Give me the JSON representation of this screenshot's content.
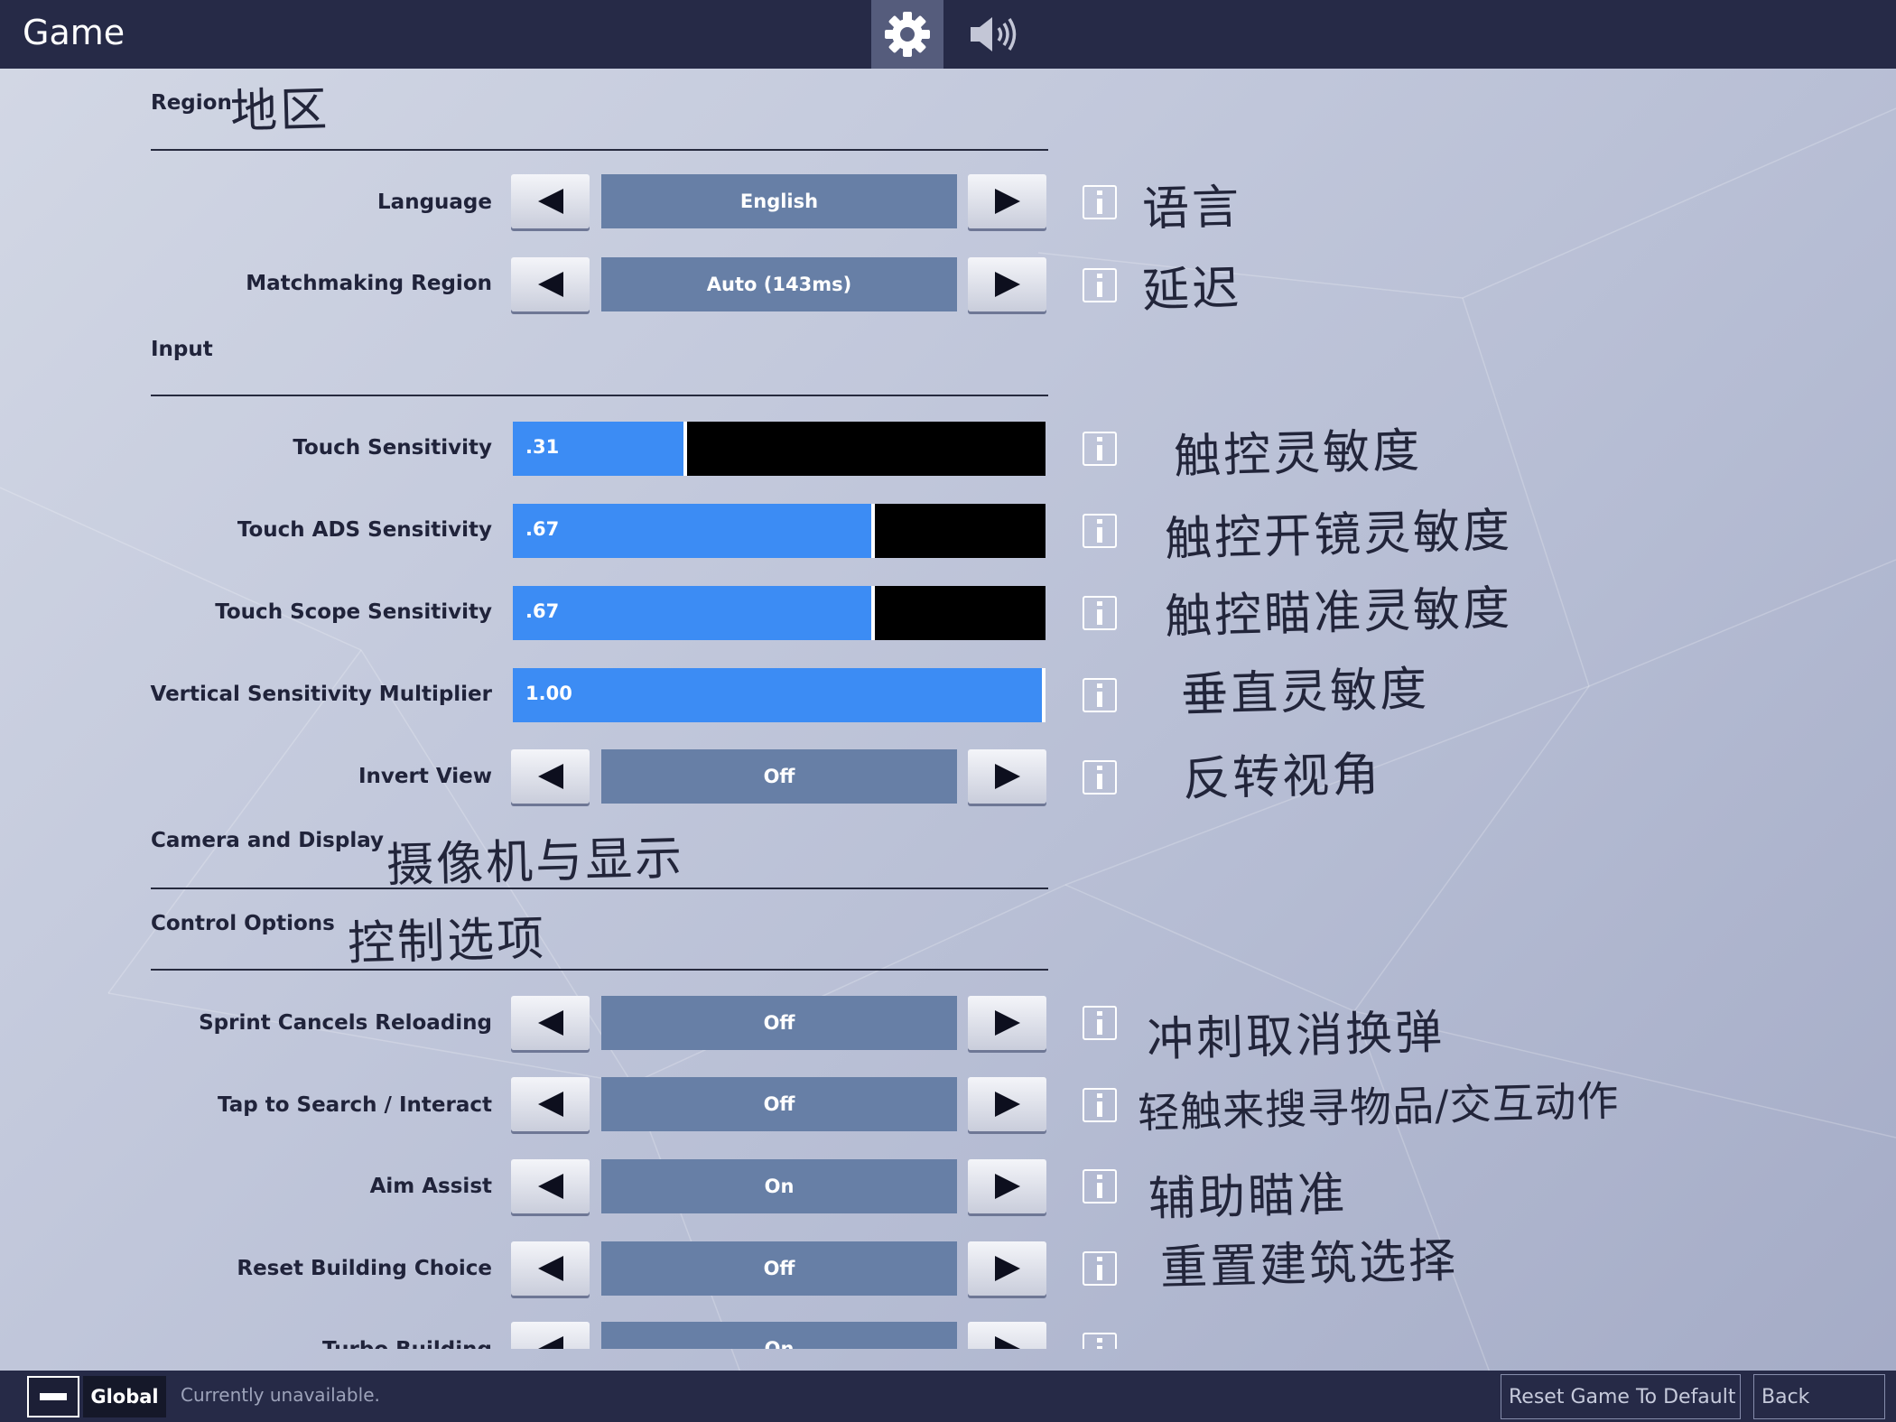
{
  "header": {
    "title": "Game",
    "tabs": [
      {
        "name": "settings",
        "icon": "gear-icon",
        "active": true
      },
      {
        "name": "audio",
        "icon": "speaker-icon",
        "active": false
      }
    ]
  },
  "sections": {
    "region": {
      "title": "Region",
      "note": "地区"
    },
    "input": {
      "title": "Input"
    },
    "camera": {
      "title": "Camera and Display",
      "note": "摄像机与显示"
    },
    "control": {
      "title": "Control Options",
      "note": "控制选项"
    }
  },
  "settings": {
    "language": {
      "label": "Language",
      "value": "English",
      "note": "语言"
    },
    "matchmaking": {
      "label": "Matchmaking Region",
      "value": "Auto (143ms)",
      "note": "延迟"
    },
    "touch_sensitivity": {
      "label": "Touch Sensitivity",
      "value": ".31",
      "level": 0.31,
      "note": "触控灵敏度"
    },
    "touch_ads": {
      "label": "Touch ADS Sensitivity",
      "value": ".67",
      "level": 0.67,
      "note": "触控开镜灵敏度"
    },
    "touch_scope": {
      "label": "Touch Scope Sensitivity",
      "value": ".67",
      "level": 0.67,
      "note": "触控瞄准灵敏度"
    },
    "vertical_multiplier": {
      "label": "Vertical Sensitivity Multiplier",
      "value": "1.00",
      "level": 1.0,
      "note": "垂直灵敏度"
    },
    "invert_view": {
      "label": "Invert View",
      "value": "Off",
      "note": "反转视角"
    },
    "sprint_cancels": {
      "label": "Sprint Cancels Reloading",
      "value": "Off",
      "note": "冲刺取消换弹"
    },
    "tap_to_search": {
      "label": "Tap to Search / Interact",
      "value": "Off",
      "note": "轻触来搜寻物品/交互动作"
    },
    "aim_assist": {
      "label": "Aim Assist",
      "value": "On",
      "note": "辅助瞄准"
    },
    "reset_building": {
      "label": "Reset Building Choice",
      "value": "Off",
      "note": "重置建筑选择"
    },
    "turbo_building": {
      "label": "Turbo Building",
      "value": "On"
    }
  },
  "footer": {
    "scope_label": "Global",
    "status": "Currently unavailable.",
    "reset_label": "Reset Game To Default",
    "back_label": "Back"
  },
  "colors": {
    "header_bg": "#262a47",
    "slider_fill": "#3c8cf4",
    "value_box": "#677fa6",
    "slider_track": "#000000"
  }
}
